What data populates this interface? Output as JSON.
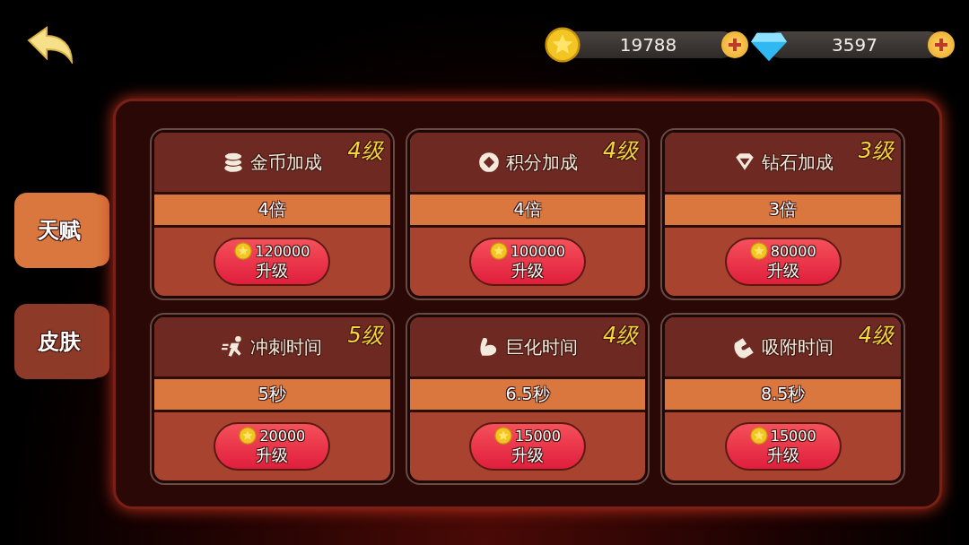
{
  "currencies": [
    {
      "kind": "coin",
      "amount": "19788"
    },
    {
      "kind": "diamond",
      "amount": "3597"
    }
  ],
  "tabs": [
    {
      "label": "天赋",
      "selected": true
    },
    {
      "label": "皮肤",
      "selected": false
    }
  ],
  "cards": [
    {
      "kind": "coins",
      "title": "金币加成",
      "level": "4级",
      "effect": "4倍",
      "cost": "120000",
      "action": "升级"
    },
    {
      "kind": "token",
      "title": "积分加成",
      "level": "4级",
      "effect": "4倍",
      "cost": "100000",
      "action": "升级"
    },
    {
      "kind": "diamond",
      "title": "钻石加成",
      "level": "3级",
      "effect": "3倍",
      "cost": "80000",
      "action": "升级"
    },
    {
      "kind": "runner",
      "title": "冲刺时间",
      "level": "5级",
      "effect": "5秒",
      "cost": "20000",
      "action": "升级"
    },
    {
      "kind": "muscle",
      "title": "巨化时间",
      "level": "4级",
      "effect": "6.5秒",
      "cost": "15000",
      "action": "升级"
    },
    {
      "kind": "magnet",
      "title": "吸附时间",
      "level": "4级",
      "effect": "8.5秒",
      "cost": "15000",
      "action": "升级"
    }
  ]
}
